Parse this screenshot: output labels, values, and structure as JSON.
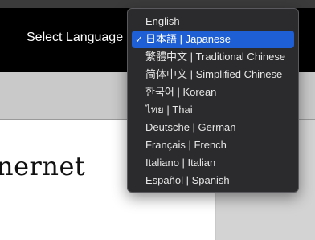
{
  "header": {
    "select_label": "Select Language"
  },
  "content": {
    "heading_fragment": "nernet"
  },
  "language_menu": {
    "selected_index": 1,
    "items": [
      {
        "label": "English"
      },
      {
        "label": "日本語 | Japanese"
      },
      {
        "label": "繁體中文 | Traditional Chinese"
      },
      {
        "label": "简体中文 | Simplified Chinese"
      },
      {
        "label": "한국어 | Korean"
      },
      {
        "label": "ไทย | Thai"
      },
      {
        "label": "Deutsche | German"
      },
      {
        "label": "Français | French"
      },
      {
        "label": "Italiano | Italian"
      },
      {
        "label": "Español | Spanish"
      }
    ],
    "check_glyph": "✓"
  },
  "colors": {
    "header_bg": "#000000",
    "menu_bg": "#2b2b2d",
    "selection": "#1f5fd6",
    "page_bg": "#c9c9c9"
  }
}
